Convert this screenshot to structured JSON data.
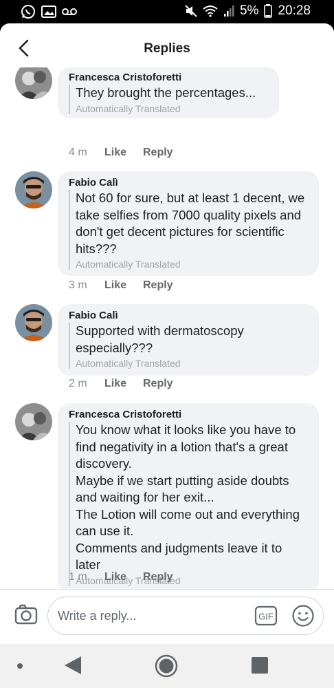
{
  "status_bar": {
    "battery": "5%",
    "time": "20:28"
  },
  "header": {
    "title": "Replies"
  },
  "comments": [
    {
      "author": "Francesca Cristoforetti",
      "text": "They brought the percentages...",
      "translated": "Automatically Translated",
      "time": "4 m",
      "like": "Like",
      "reply": "Reply"
    },
    {
      "author": "Fabio Calì",
      "text": "Not 60 for sure, but at least 1 decent, we take selfies from 7000 quality pixels and don't get decent pictures for scientific hits???",
      "translated": "Automatically Translated",
      "time": "3 m",
      "like": "Like",
      "reply": "Reply"
    },
    {
      "author": "Fabio Calì",
      "text": "Supported with dermatoscopy especially???",
      "translated": "Automatically Translated",
      "time": "2 m",
      "like": "Like",
      "reply": "Reply"
    },
    {
      "author": "Francesca Cristoforetti",
      "text": "You know what it looks like you have to find negativity in a lotion that's a great discovery.\nMaybe if we start putting aside doubts and waiting for her exit...\nThe Lotion will come out and everything can use it.\nComments and judgments leave it to later",
      "translated": "Automatically Translated",
      "time": "1 m",
      "like": "Like",
      "reply": "Reply"
    }
  ],
  "composer": {
    "placeholder": "Write a reply...",
    "gif_label": "GIF"
  },
  "icons": {
    "back": "chevron-left-icon",
    "camera": "camera-icon",
    "gif": "gif-icon",
    "emoji": "emoji-icon",
    "nav_back": "triangle-back-icon",
    "nav_home": "circle-home-icon",
    "nav_recent": "square-recent-icon"
  },
  "colors": {
    "bubble": "#f0f2f5",
    "text": "#1c1e21",
    "secondary": "#65676b"
  }
}
